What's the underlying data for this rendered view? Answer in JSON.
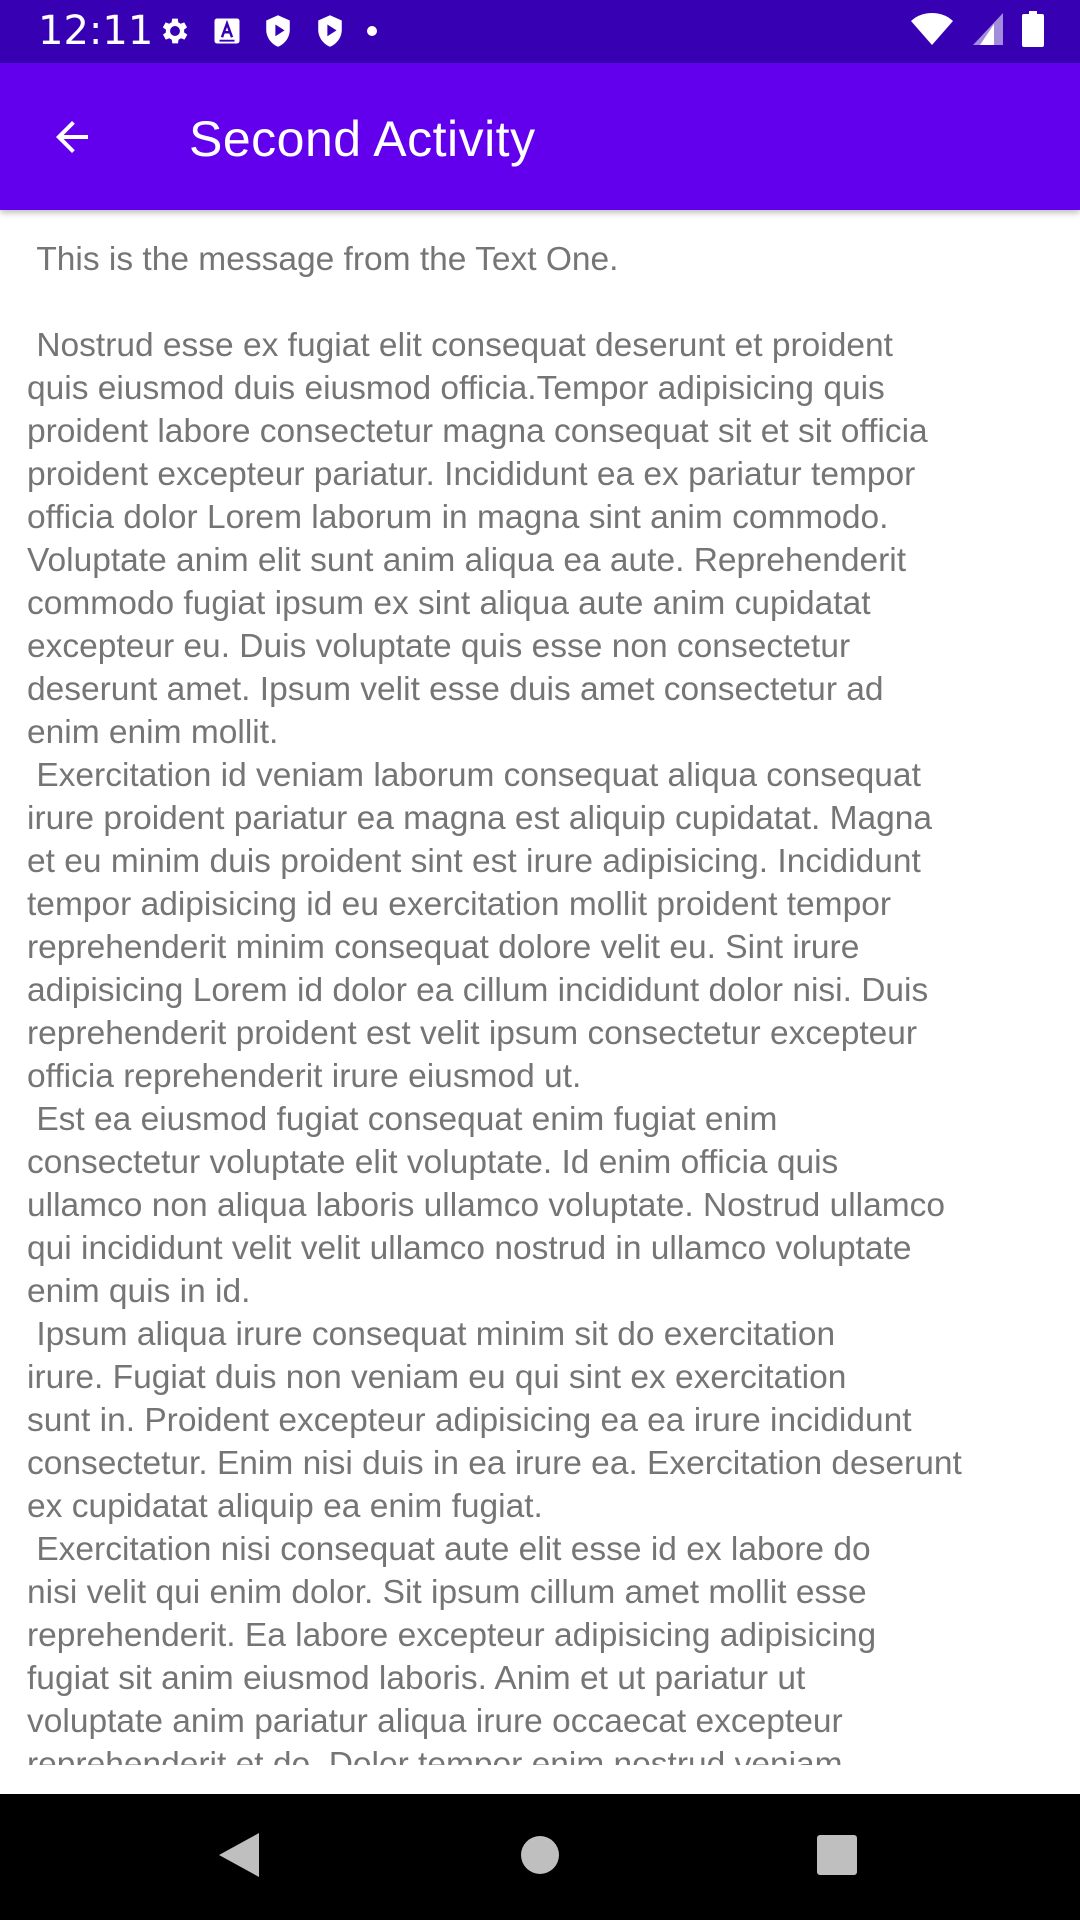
{
  "status_bar": {
    "time": "12:11",
    "left_icons": [
      "settings-icon",
      "text-input-icon",
      "shield-play-icon",
      "shield-play-icon",
      "dot-icon"
    ],
    "right_icons": [
      "wifi-icon",
      "signal-icon",
      "battery-icon"
    ]
  },
  "app_bar": {
    "title": "Second Activity",
    "back_icon": "arrow-back-icon",
    "color": "#6200ee",
    "status_color": "#3700b3"
  },
  "content": {
    "message": " This is the message from the Text One.\n\n Nostrud esse ex fugiat elit consequat deserunt et proident\nquis eiusmod duis eiusmod officia.Tempor adipisicing quis\nproident labore consectetur magna consequat sit et sit officia\nproident excepteur pariatur. Incididunt ea ex pariatur tempor\nofficia dolor Lorem laborum in magna sint anim commodo.\nVoluptate anim elit sunt anim aliqua ea aute. Reprehenderit\ncommodo fugiat ipsum ex sint aliqua aute anim cupidatat\nexcepteur eu. Duis voluptate quis esse non consectetur\ndeserunt amet. Ipsum velit esse duis amet consectetur ad\nenim enim mollit.\n Exercitation id veniam laborum consequat aliqua consequat\nirure proident pariatur ea magna est aliquip cupidatat. Magna\net eu minim duis proident sint est irure adipisicing. Incididunt\ntempor adipisicing id eu exercitation mollit proident tempor\nreprehenderit minim consequat dolore velit eu. Sint irure\nadipisicing Lorem id dolor ea cillum incididunt dolor nisi. Duis\nreprehenderit proident est velit ipsum consectetur excepteur\nofficia reprehenderit irure eiusmod ut.\n Est ea eiusmod fugiat consequat enim fugiat enim\nconsectetur voluptate elit voluptate. Id enim officia quis\nullamco non aliqua laboris ullamco voluptate. Nostrud ullamco\nqui incididunt velit velit ullamco nostrud in ullamco voluptate\nenim quis in id.\n Ipsum aliqua irure consequat minim sit do exercitation\nirure. Fugiat duis non veniam eu qui sint ex exercitation\nsunt in. Proident excepteur adipisicing ea ea irure incididunt\nconsectetur. Enim nisi duis in ea irure ea. Exercitation deserunt\nex cupidatat aliquip ea enim fugiat.\n Exercitation nisi consequat aute elit esse id ex labore do\nnisi velit qui enim dolor. Sit ipsum cillum amet mollit esse\nreprehenderit. Ea labore excepteur adipisicing adipisicing\nfugiat sit anim eiusmod laboris. Anim et ut pariatur ut\nvoluptate anim pariatur aliqua irure occaecat excepteur\nreprehenderit et do. Dolor tempor enim nostrud veniam"
  },
  "nav_bar": {
    "buttons": [
      "back-triangle-icon",
      "home-circle-icon",
      "recents-square-icon"
    ]
  }
}
